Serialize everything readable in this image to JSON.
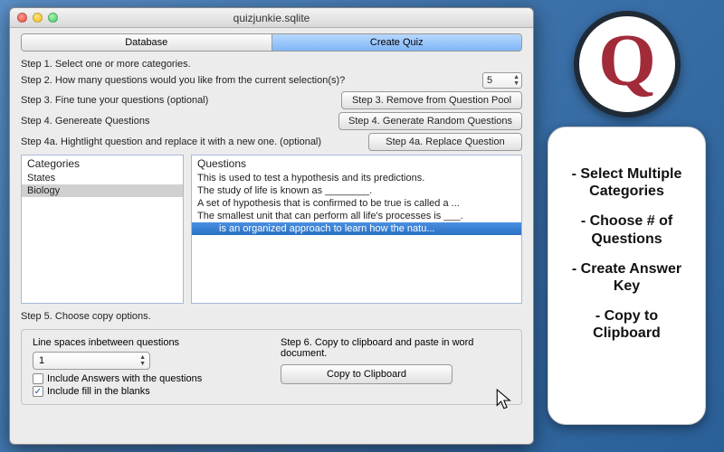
{
  "window": {
    "title": "quizjunkie.sqlite"
  },
  "tabs": {
    "database": "Database",
    "create_quiz": "Create Quiz"
  },
  "steps": {
    "s1": "Step 1. Select one or more categories.",
    "s2": "Step 2. How many questions would you like from the current selection(s)?",
    "s2_value": "5",
    "s3": "Step 3. Fine tune your questions (optional)",
    "s3_btn": "Step 3. Remove from Question Pool",
    "s4": "Step 4. Genereate Questions",
    "s4_btn": "Step 4. Generate Random Questions",
    "s4a": "Step 4a. Hightlight question and replace it with a new one. (optional)",
    "s4a_btn": "Step 4a. Replace Question",
    "s5": "Step 5. Choose copy options.",
    "s6": "Step 6. Copy to clipboard and paste in word document."
  },
  "categories": {
    "header": "Categories",
    "items": [
      "States",
      "Biology"
    ]
  },
  "questions": {
    "header": "Questions",
    "items": [
      "This is used to test a hypothesis and its predictions.",
      "The study of life is known as ________.",
      "A set of hypothesis that is confirmed to be true is called a ...",
      "The smallest unit that can perform all life's processes is ___.",
      "is an organized approach to learn how the natu..."
    ]
  },
  "copy_options": {
    "line_spaces_label": "Line spaces inbetween questions",
    "line_spaces_value": "1",
    "include_answers": "Include Answers with the questions",
    "include_blanks": "Include fill in the blanks",
    "copy_btn": "Copy to Clipboard"
  },
  "promo": {
    "p1": "- Select Multiple Categories",
    "p2": "- Choose # of Questions",
    "p3": "- Create Answer Key",
    "p4": "- Copy to Clipboard"
  }
}
